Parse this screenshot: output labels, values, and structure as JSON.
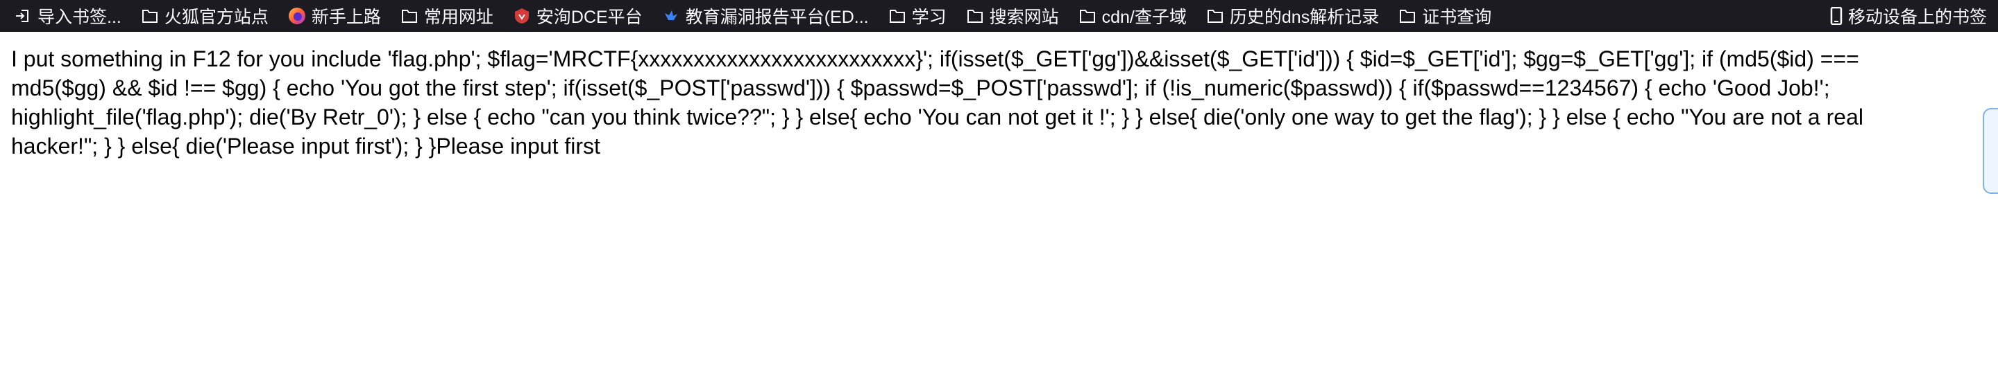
{
  "bookmarks": {
    "items": [
      {
        "label": "导入书签...",
        "icon": "import-icon"
      },
      {
        "label": "火狐官方站点",
        "icon": "folder-icon"
      },
      {
        "label": "新手上路",
        "icon": "firefox-icon"
      },
      {
        "label": "常用网址",
        "icon": "folder-icon"
      },
      {
        "label": "安洵DCE平台",
        "icon": "shield-logo-icon"
      },
      {
        "label": "教育漏洞报告平台(ED...",
        "icon": "bird-logo-icon"
      },
      {
        "label": "学习",
        "icon": "folder-icon"
      },
      {
        "label": "搜索网站",
        "icon": "folder-icon"
      },
      {
        "label": "cdn/查子域",
        "icon": "folder-icon"
      },
      {
        "label": "历史的dns解析记录",
        "icon": "folder-icon"
      },
      {
        "label": "证书查询",
        "icon": "folder-icon"
      }
    ],
    "mobile": {
      "label": "移动设备上的书签",
      "icon": "mobile-icon"
    }
  },
  "page": {
    "text": "I put something in F12 for you include 'flag.php'; $flag='MRCTF{xxxxxxxxxxxxxxxxxxxxxxxxx}'; if(isset($_GET['gg'])&&isset($_GET['id'])) { $id=$_GET['id']; $gg=$_GET['gg']; if (md5($id) === md5($gg) && $id !== $gg) { echo 'You got the first step'; if(isset($_POST['passwd'])) { $passwd=$_POST['passwd']; if (!is_numeric($passwd)) { if($passwd==1234567) { echo 'Good Job!'; highlight_file('flag.php'); die('By Retr_0'); } else { echo \"can you think twice??\"; } } else{ echo 'You can not get it !'; } } else{ die('only one way to get the flag'); } } else { echo \"You are not a real hacker!\"; } } else{ die('Please input first'); } }Please input first"
  },
  "colors": {
    "bar_bg": "#1c1b22",
    "bar_text": "#fbfbfe",
    "page_bg": "#ffffff",
    "scroll_accent": "#7fb2ea"
  }
}
